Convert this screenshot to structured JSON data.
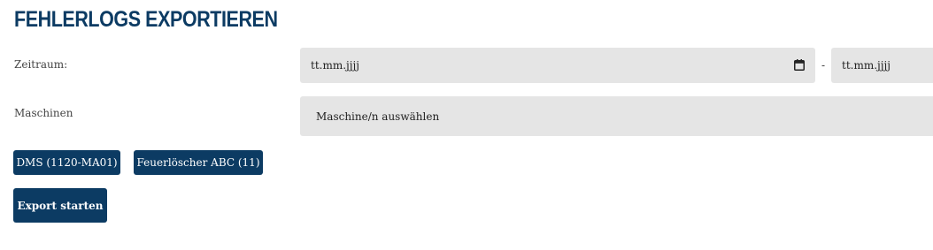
{
  "page": {
    "title": "FEHLERLOGS EXPORTIEREN"
  },
  "form": {
    "period_label": "Zeitraum:",
    "date_from_placeholder": "tt.mm.jjjj",
    "range_separator": "-",
    "date_to_placeholder": "tt.mm.jjjj",
    "machines_label": "Maschinen",
    "machines_placeholder": "Maschine/n auswählen"
  },
  "selected_machines": [
    {
      "label": "DMS  (1120-MA01)"
    },
    {
      "label": "Feuerlöscher ABC  (11)"
    }
  ],
  "actions": {
    "export_label": "Export starten"
  },
  "colors": {
    "brand": "#0c3b63",
    "field_bg": "#e5e5e5"
  },
  "icons": {
    "date_picker": "calendar-icon"
  }
}
